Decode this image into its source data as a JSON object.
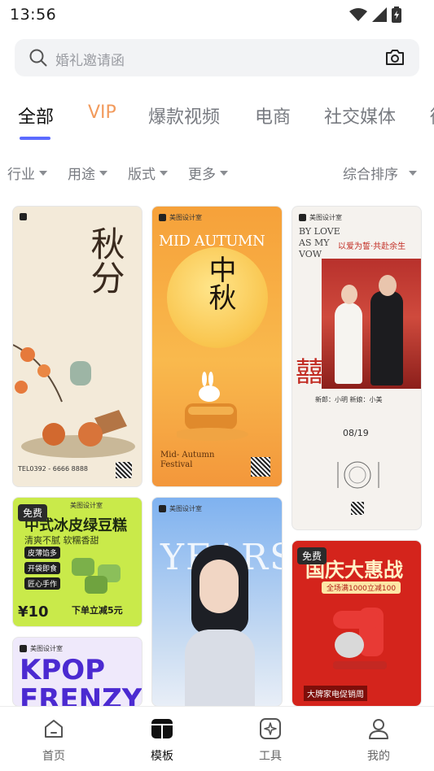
{
  "status": {
    "time": "13:56"
  },
  "search": {
    "placeholder": "婚礼邀请函"
  },
  "tabs": [
    {
      "label": "全部",
      "active": true
    },
    {
      "label": "VIP"
    },
    {
      "label": "爆款视频"
    },
    {
      "label": "电商"
    },
    {
      "label": "社交媒体"
    },
    {
      "label": "街"
    }
  ],
  "filters": {
    "industry": "行业",
    "usage": "用途",
    "format": "版式",
    "more": "更多",
    "sort": "综合排序"
  },
  "cards": {
    "autumn": {
      "title": "秋分",
      "phone": "TEL0392 - 6666 8888"
    },
    "mid_autumn": {
      "title_en": "MID AUTUMN",
      "title_cn": "中秋",
      "footer": "Mid- Autumn Festival",
      "brand": "美图设计室"
    },
    "wedding": {
      "brand": "美图设计室",
      "headline_en": "BY LOVE AS MY VOW",
      "headline_cn": "以爱为誓·共赴余生",
      "names": "新郎：小明  新娘：小美",
      "date": "08/19"
    },
    "bean_cake": {
      "badge": "免费",
      "brand": "美图设计室",
      "title": "中式冰皮绿豆糕",
      "subtitle": "清爽不腻 软糯香甜",
      "tags": [
        "皮薄馅多",
        "开袋即食",
        "匠心手作"
      ],
      "price": "¥10",
      "promo": "下单立减5元"
    },
    "years": {
      "brand": "美图设计室",
      "title": "YEARS"
    },
    "national_day": {
      "badge": "免费",
      "title": "国庆大惠战",
      "sub": "全场满1000立减100",
      "footer": "大牌家电促销周"
    },
    "kpop": {
      "brand": "美图设计室",
      "title": "KPOP FRENZY"
    }
  },
  "nav": [
    {
      "label": "首页"
    },
    {
      "label": "模板",
      "active": true
    },
    {
      "label": "工具"
    },
    {
      "label": "我的"
    }
  ],
  "colors": {
    "accent": "#5c6bff",
    "vip": "#f29b5d"
  }
}
